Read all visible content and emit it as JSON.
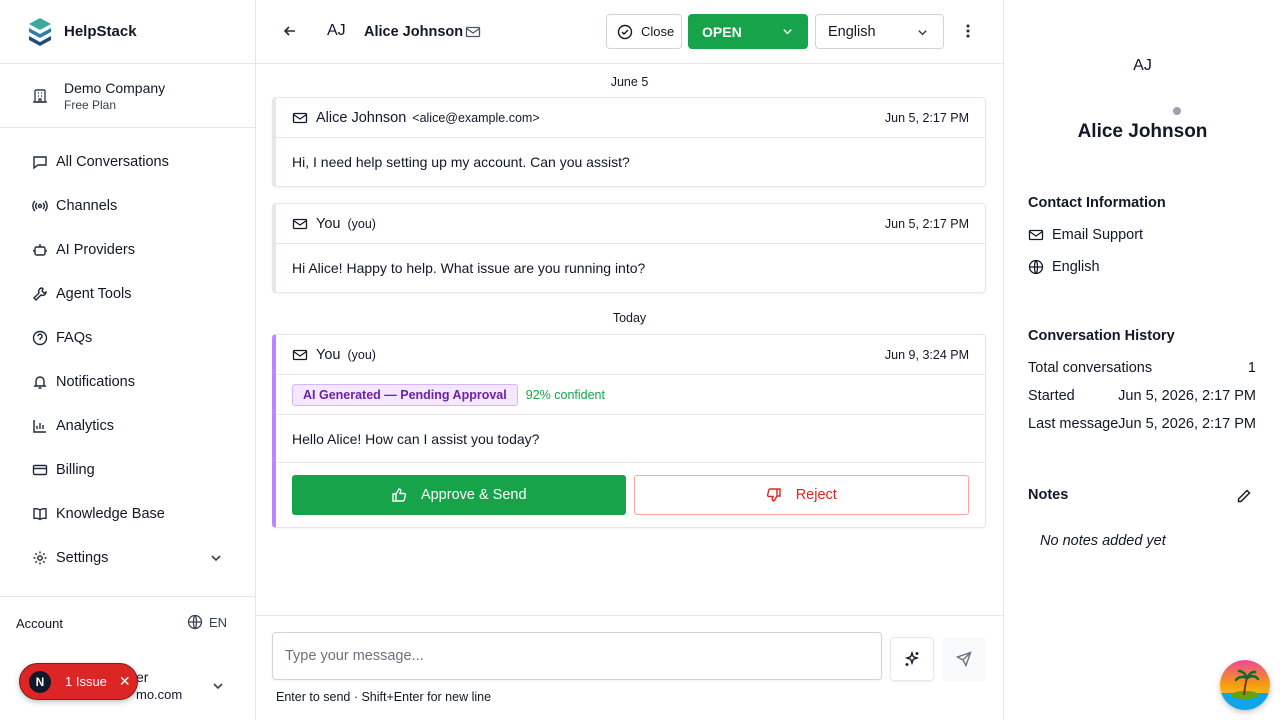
{
  "brand": {
    "name": "HelpStack"
  },
  "company": {
    "name": "Demo Company",
    "plan": "Free Plan"
  },
  "nav": {
    "items": [
      {
        "label": "All Conversations",
        "icon": "chat-icon"
      },
      {
        "label": "Channels",
        "icon": "broadcast-icon"
      },
      {
        "label": "AI Providers",
        "icon": "robot-icon"
      },
      {
        "label": "Agent Tools",
        "icon": "wrench-icon"
      },
      {
        "label": "FAQs",
        "icon": "help-circle-icon"
      },
      {
        "label": "Notifications",
        "icon": "bell-icon"
      },
      {
        "label": "Analytics",
        "icon": "bar-chart-icon"
      },
      {
        "label": "Billing",
        "icon": "credit-card-icon"
      },
      {
        "label": "Knowledge Base",
        "icon": "book-icon"
      },
      {
        "label": "Settings",
        "icon": "gear-icon"
      }
    ]
  },
  "account": {
    "label": "Account",
    "language": "EN",
    "user_name_partial": "er",
    "user_email_partial": "mo.com"
  },
  "issues": {
    "badge": "N",
    "label": "1 Issue"
  },
  "header": {
    "initials": "AJ",
    "name": "Alice Johnson",
    "close_label": "Close",
    "status": "OPEN",
    "language": "English"
  },
  "thread": {
    "days": [
      "June 5",
      "Today"
    ],
    "messages": [
      {
        "sender": "Alice Johnson",
        "address": "<alice@example.com>",
        "time": "Jun 5, 2:17 PM",
        "body": "Hi, I need help setting up my account. Can you assist?"
      },
      {
        "sender": "You",
        "you_tag": "(you)",
        "time": "Jun 5, 2:17 PM",
        "body": "Hi Alice! Happy to help. What issue are you running into?"
      },
      {
        "sender": "You",
        "you_tag": "(you)",
        "time": "Jun 9, 3:24 PM",
        "ai_badge": "AI Generated — Pending Approval",
        "confidence": "92% confident",
        "body": "Hello Alice! How can I assist you today?",
        "approve_label": "Approve & Send",
        "reject_label": "Reject"
      }
    ]
  },
  "composer": {
    "placeholder": "Type your message...",
    "hint": "Enter to send · Shift+Enter for new line"
  },
  "contact": {
    "initials": "AJ",
    "name": "Alice Johnson",
    "info_title": "Contact Information",
    "channel": "Email Support",
    "language": "English",
    "history_title": "Conversation History",
    "history": [
      {
        "key": "Total conversations",
        "value": "1"
      },
      {
        "key": "Started",
        "value": "Jun 5, 2026, 2:17 PM"
      },
      {
        "key": "Last message",
        "value": "Jun 5, 2026, 2:17 PM"
      }
    ],
    "notes_title": "Notes",
    "notes_empty": "No notes added yet"
  },
  "colors": {
    "accent_green": "#16a34a",
    "danger_red": "#dc2626",
    "ai_purple": "#c084fc"
  }
}
